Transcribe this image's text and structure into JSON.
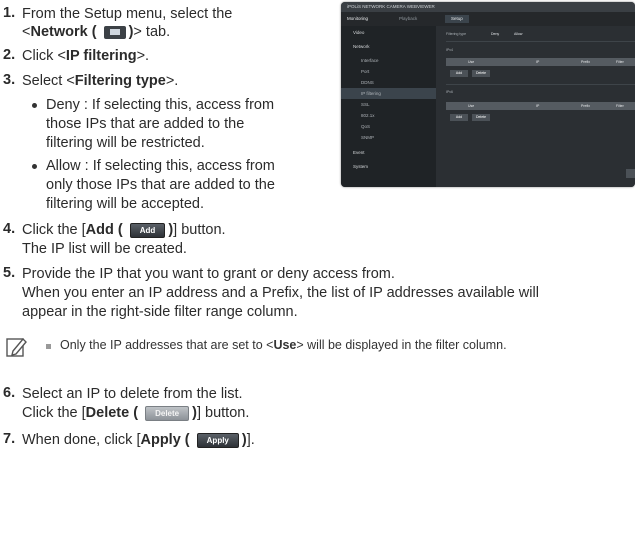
{
  "steps": {
    "s1": {
      "num": "1.",
      "a": "From the Setup menu, select the",
      "b_pre": "<",
      "b_bold": "Network (",
      "b_bold2": ")",
      "b_post": "> tab."
    },
    "s2": {
      "num": "2.",
      "pre": "Click <",
      "bold": "IP filtering",
      "post": ">."
    },
    "s3": {
      "num": "3.",
      "pre": "Select <",
      "bold": "Filtering type",
      "post": ">."
    },
    "deny": [
      "Deny : If selecting this, access from",
      "those IPs that are added to the",
      "filtering will be restricted."
    ],
    "allow": [
      "Allow : If selecting this, access from",
      "only those IPs that are added to the",
      "filtering will be accepted."
    ],
    "s4": {
      "num": "4.",
      "pre": "Click the [",
      "bold": "Add (",
      "bold2": ")",
      "post": "] button.",
      "line2": "The IP list will be created."
    },
    "s5": {
      "num": "5.",
      "line1": "Provide the IP that you want to grant or deny access from.",
      "line2": "When you enter an IP address and a Prefix, the list of IP addresses available will",
      "line3": "appear in the right-side filter range column."
    },
    "note": {
      "pre": "Only the IP addresses that are set to <",
      "bold": "Use",
      "post": "> will be displayed in the filter column."
    },
    "s6": {
      "num": "6.",
      "line1": "Select an IP to delete from the list.",
      "pre": "Click the [",
      "bold": "Delete (",
      "bold2": ")",
      "post": "] button."
    },
    "s7": {
      "num": "7.",
      "pre": "When done, click [",
      "bold": "Apply (",
      "bold2": ")",
      "post": "]."
    }
  },
  "buttons": {
    "add": "Add",
    "delete": "Delete",
    "apply": "Apply"
  },
  "screenshot": {
    "title": "iPOLiS NETWORK CAMERA WEBVIEWER",
    "nav": {
      "monitoring": "Monitoring",
      "playback": "Playback",
      "setup": "Setup"
    },
    "side": [
      "Video",
      "Network",
      "Interface",
      "Port",
      "DDNS",
      "IP filtering",
      "SSL",
      "802.1x",
      "QoS",
      "SNMP",
      "Event",
      "System"
    ],
    "filtering_type_label": "Filtering type",
    "deny": "Deny",
    "allow": "Allow",
    "ipv4": "IPv4",
    "ipv6": "IPv6",
    "cols": [
      "Use",
      "IP",
      "Prefix",
      "Filter"
    ],
    "add": "Add",
    "delete": "Delete"
  }
}
